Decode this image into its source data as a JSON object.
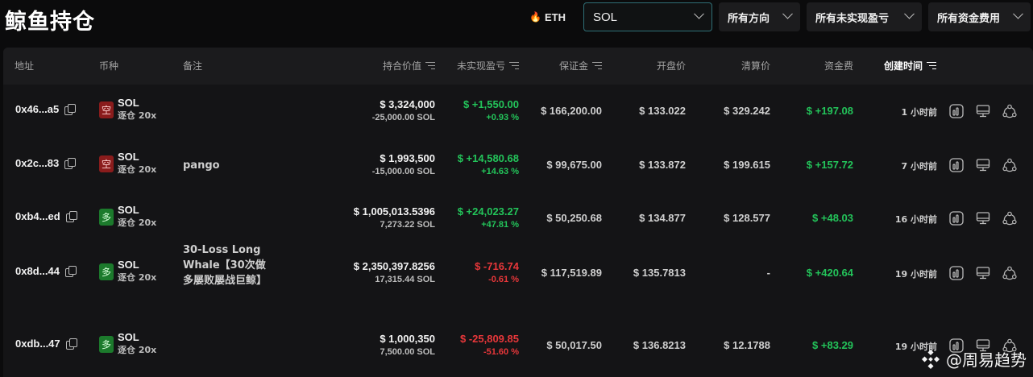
{
  "page": {
    "title": "鲸鱼持仓"
  },
  "filters": {
    "eth_label": "ETH",
    "symbol_value": "SOL",
    "direction_label": "所有方向",
    "pnl_label": "所有未实现盈亏",
    "funding_label": "所有资金费用"
  },
  "table": {
    "headers": {
      "address": "地址",
      "symbol": "币种",
      "note": "备注",
      "value": "持合价值",
      "upnl": "未实现盈亏",
      "margin": "保证金",
      "open_price": "开盘价",
      "liq_price": "清算价",
      "funding": "资金费",
      "created": "创建时间"
    },
    "rows": [
      {
        "address": "0x46...a5",
        "side": "空",
        "side_type": "short",
        "symbol": "SOL",
        "leverage": "逐仓 20x",
        "note": "",
        "value": "$ 3,324,000",
        "size": "-25,000.00 SOL",
        "pnl": "$ +1,550.00",
        "pnl_pct": "+0.93 %",
        "pnl_sign": "pos",
        "margin": "$ 166,200.00",
        "open_price": "$ 133.022",
        "liq_price": "$ 329.242",
        "funding": "$ +197.08",
        "created": "1 小时前"
      },
      {
        "address": "0x2c...83",
        "side": "空",
        "side_type": "short",
        "symbol": "SOL",
        "leverage": "逐仓 20x",
        "note": "pango",
        "value": "$ 1,993,500",
        "size": "-15,000.00 SOL",
        "pnl": "$ +14,580.68",
        "pnl_pct": "+14.63 %",
        "pnl_sign": "pos",
        "margin": "$ 99,675.00",
        "open_price": "$ 133.872",
        "liq_price": "$ 199.615",
        "funding": "$ +157.72",
        "created": "7 小时前"
      },
      {
        "address": "0xb4...ed",
        "side": "多",
        "side_type": "long",
        "symbol": "SOL",
        "leverage": "逐仓 20x",
        "note": "",
        "value": "$ 1,005,013.5396",
        "size": "7,273.22 SOL",
        "pnl": "$ +24,023.27",
        "pnl_pct": "+47.81 %",
        "pnl_sign": "pos",
        "margin": "$ 50,250.68",
        "open_price": "$ 134.877",
        "liq_price": "$ 128.577",
        "funding": "$ +48.03",
        "created": "16 小时前"
      },
      {
        "address": "0x8d...44",
        "side": "多",
        "side_type": "long",
        "symbol": "SOL",
        "leverage": "逐仓 20x",
        "note": "30-Loss Long Whale【30次做多屡败屡战巨鲸】",
        "value": "$ 2,350,397.8256",
        "size": "17,315.44 SOL",
        "pnl": "$ -716.74",
        "pnl_pct": "-0.61 %",
        "pnl_sign": "neg",
        "margin": "$ 117,519.89",
        "open_price": "$ 135.7813",
        "liq_price": "-",
        "funding": "$ +420.64",
        "created": "19 小时前"
      },
      {
        "address": "0xdb...47",
        "side": "多",
        "side_type": "long",
        "symbol": "SOL",
        "leverage": "逐仓 20x",
        "note": "",
        "value": "$ 1,000,350",
        "size": "7,500.00 SOL",
        "pnl": "$ -25,809.85",
        "pnl_pct": "-51.60 %",
        "pnl_sign": "neg",
        "margin": "$ 50,017.50",
        "open_price": "$ 136.8213",
        "liq_price": "$ 12.1788",
        "funding": "$ +83.29",
        "created": "19 小时前"
      }
    ]
  },
  "watermark": {
    "text": "@周易趋势"
  },
  "colors": {
    "positive": "#23c45a",
    "negative": "#e8373a",
    "short_badge": "#8a1c1c",
    "long_badge": "#1c7a2c",
    "accent_border": "#2f6f76"
  },
  "icons": [
    "fire-icon",
    "chevron-down-icon",
    "sort-icon",
    "copy-icon",
    "chart-icon",
    "monitor-icon",
    "share-icon",
    "binance-square-icon"
  ]
}
